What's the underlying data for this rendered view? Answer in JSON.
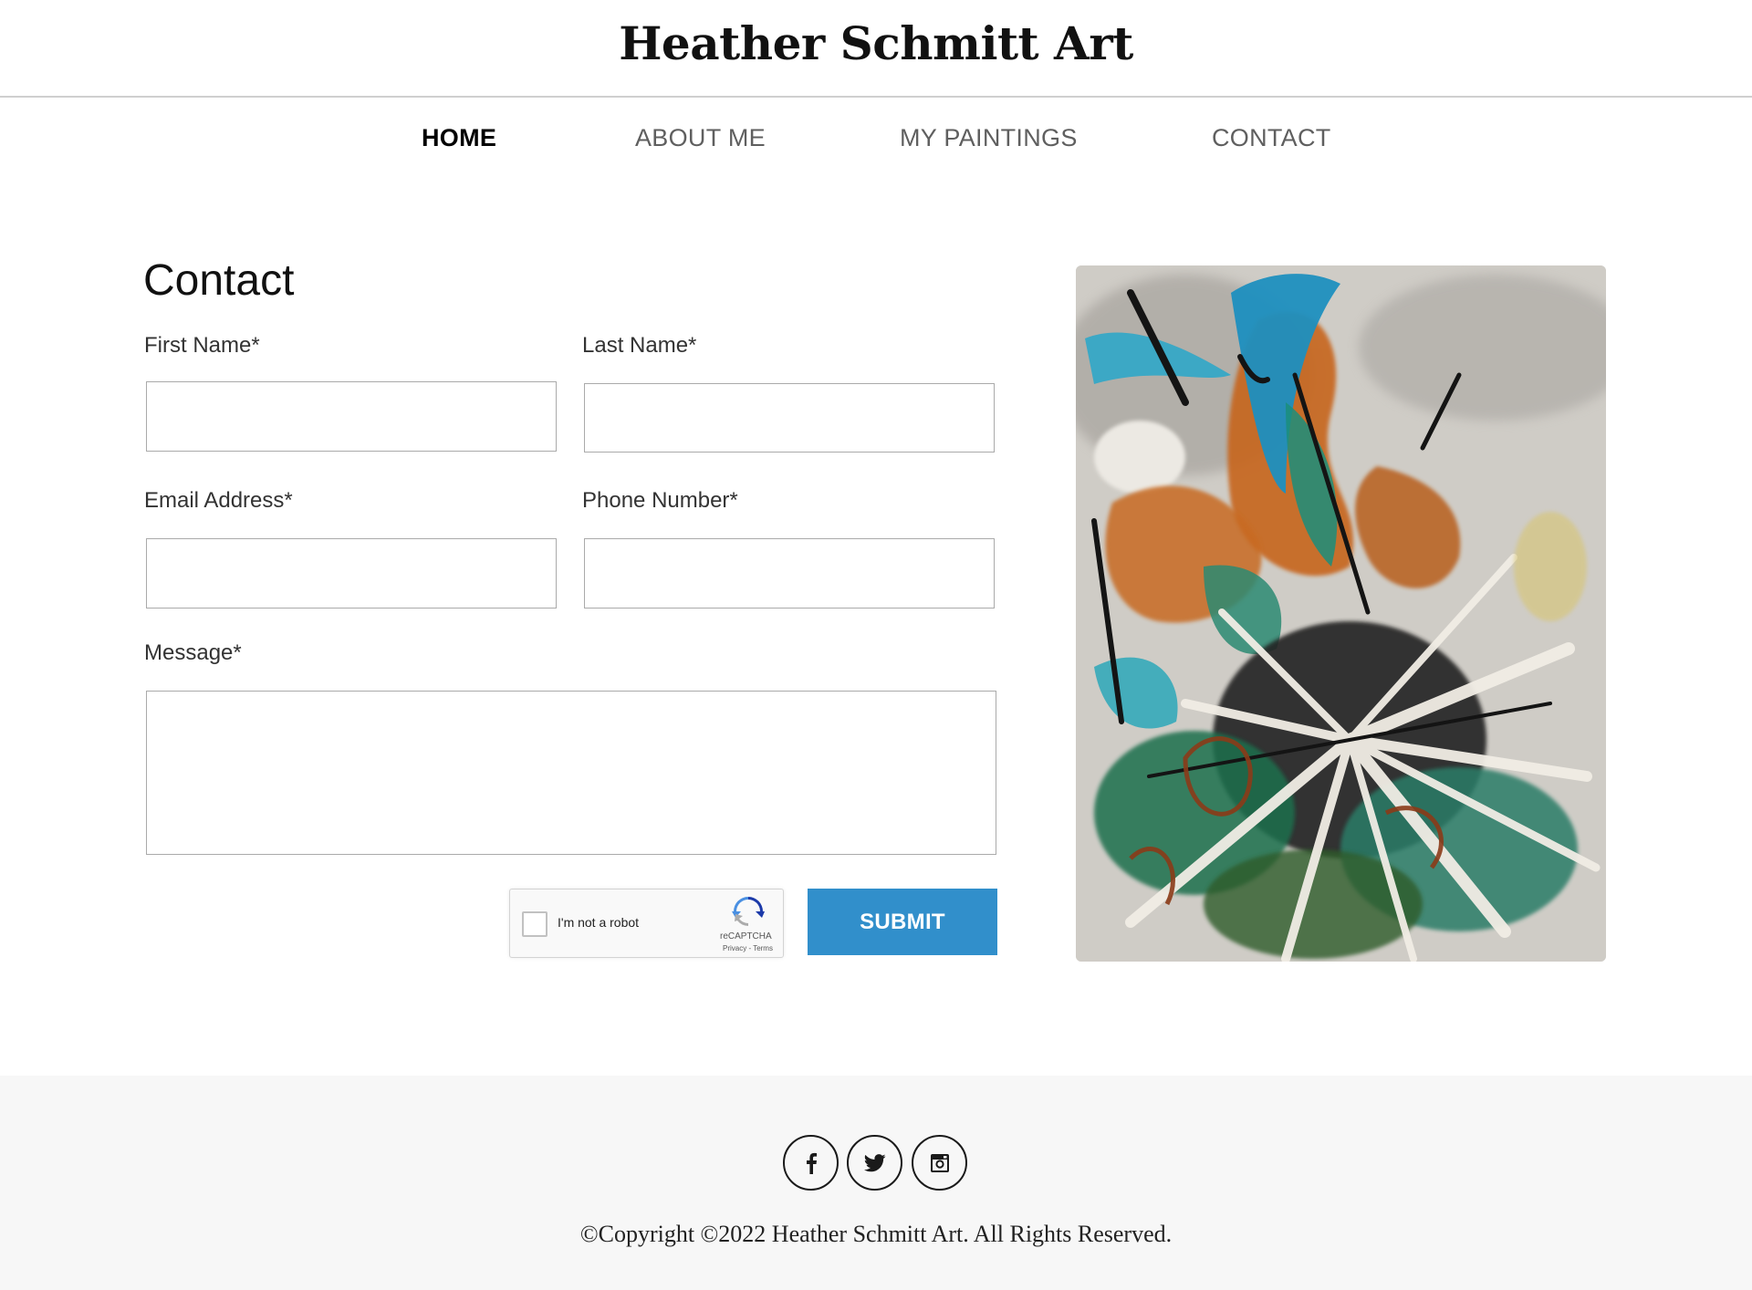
{
  "site": {
    "title": "Heather Schmitt Art"
  },
  "nav": {
    "items": [
      {
        "label": "HOME",
        "active": true
      },
      {
        "label": "ABOUT ME",
        "active": false
      },
      {
        "label": "MY PAINTINGS",
        "active": false
      },
      {
        "label": "CONTACT",
        "active": false
      }
    ]
  },
  "contact": {
    "heading": "Contact",
    "fields": {
      "first_name": {
        "label": "First Name*",
        "value": ""
      },
      "last_name": {
        "label": "Last Name*",
        "value": ""
      },
      "email": {
        "label": "Email Address*",
        "value": ""
      },
      "phone": {
        "label": "Phone Number*",
        "value": ""
      },
      "message": {
        "label": "Message*",
        "value": ""
      }
    },
    "captcha": {
      "label": "I'm not a robot",
      "brand": "reCAPTCHA",
      "links": "Privacy - Terms",
      "checked": false
    },
    "submit_label": "SUBMIT"
  },
  "painting": {
    "icon": "abstract-painting-image"
  },
  "footer": {
    "social": [
      {
        "icon": "facebook-icon"
      },
      {
        "icon": "twitter-icon"
      },
      {
        "icon": "instagram-icon"
      }
    ],
    "copyright": "©Copyright ©2022 Heather Schmitt Art. All Rights Reserved."
  },
  "colors": {
    "accent": "#318fcb",
    "footer_bg": "#f7f7f7",
    "nav_active": "#000000",
    "nav_inactive": "#5f5f5f"
  }
}
